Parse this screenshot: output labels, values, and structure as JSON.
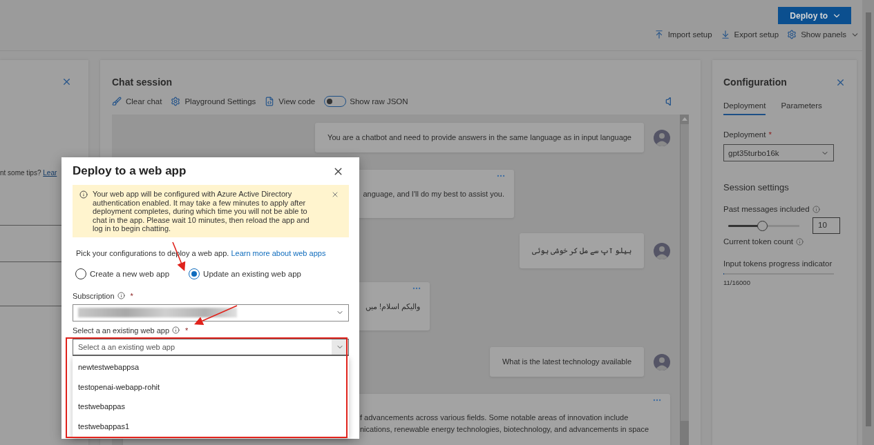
{
  "top_bar": {
    "deploy_button": "Deploy to",
    "actions": [
      "Import setup",
      "Export setup",
      "Show panels"
    ]
  },
  "left_panel": {
    "tip_text": "nt some tips?",
    "tip_link": "Lear"
  },
  "chat": {
    "title": "Chat session",
    "toolbar": [
      {
        "kind": "button",
        "label": "Clear chat"
      },
      {
        "kind": "button",
        "label": "Playground Settings"
      },
      {
        "kind": "button",
        "label": "View code"
      },
      {
        "kind": "toggle",
        "label": "Show raw JSON",
        "on": false
      }
    ],
    "messages": [
      {
        "kind": "user",
        "lines": [
          "You are a chatbot and need to provide answers in the same language as in input language"
        ]
      },
      {
        "kind": "assistant",
        "lines": [
          "anguage, and I'll do my best to assist you."
        ]
      },
      {
        "kind": "user",
        "lines": [
          "ہیلو آپ سے مل کر خوشی ہوئی"
        ]
      },
      {
        "kind": "assistant",
        "lines": [
          "والیکم اسلام! میں"
        ]
      },
      {
        "kind": "user",
        "lines": [
          "What is the latest technology available"
        ]
      },
      {
        "kind": "assistant",
        "lines": [
          "f advancements across various fields. Some notable areas of innovation include",
          "nications, renewable energy technologies, biotechnology, and advancements in space"
        ]
      }
    ]
  },
  "configuration": {
    "title": "Configuration",
    "tabs": [
      {
        "label": "Deployment",
        "selected": true
      },
      {
        "label": "Parameters",
        "selected": false
      }
    ],
    "deployment_label": "Deployment",
    "deployment_required": "*",
    "deployment_value": "gpt35turbo16k",
    "session_title": "Session settings",
    "past_messages": {
      "label": "Past messages included",
      "level": 0.48,
      "value": "10"
    },
    "token_count_label": "Current token count",
    "progress": {
      "label": "Input tokens progress indicator",
      "level": 0.0007,
      "reading": "11/16000"
    }
  },
  "modal": {
    "title": "Deploy to a web app",
    "warning": "Your web app will be configured with Azure Active Directory authentication enabled. It may take a few minutes to apply after deployment completes, during which time you will not be able to chat in the app. Please wait 10 minutes, then reload the app and log in to begin chatting.",
    "intro": "Pick your configurations to deploy a web app.",
    "intro_link": "Learn more about web apps",
    "options": [
      {
        "label": "Create a new web app",
        "selected": false
      },
      {
        "label": "Update an existing web app",
        "selected": true
      }
    ],
    "subscription_label": "Subscription",
    "subscription_required": "*",
    "webapp_label": "Select a an existing web app",
    "webapp_required": "*",
    "webapp_placeholder": "Select a an existing web app",
    "webapp_options": [
      "newtestwebappsa",
      "testopenai-webapp-rohit",
      "testwebappas",
      "testwebappas1"
    ]
  }
}
